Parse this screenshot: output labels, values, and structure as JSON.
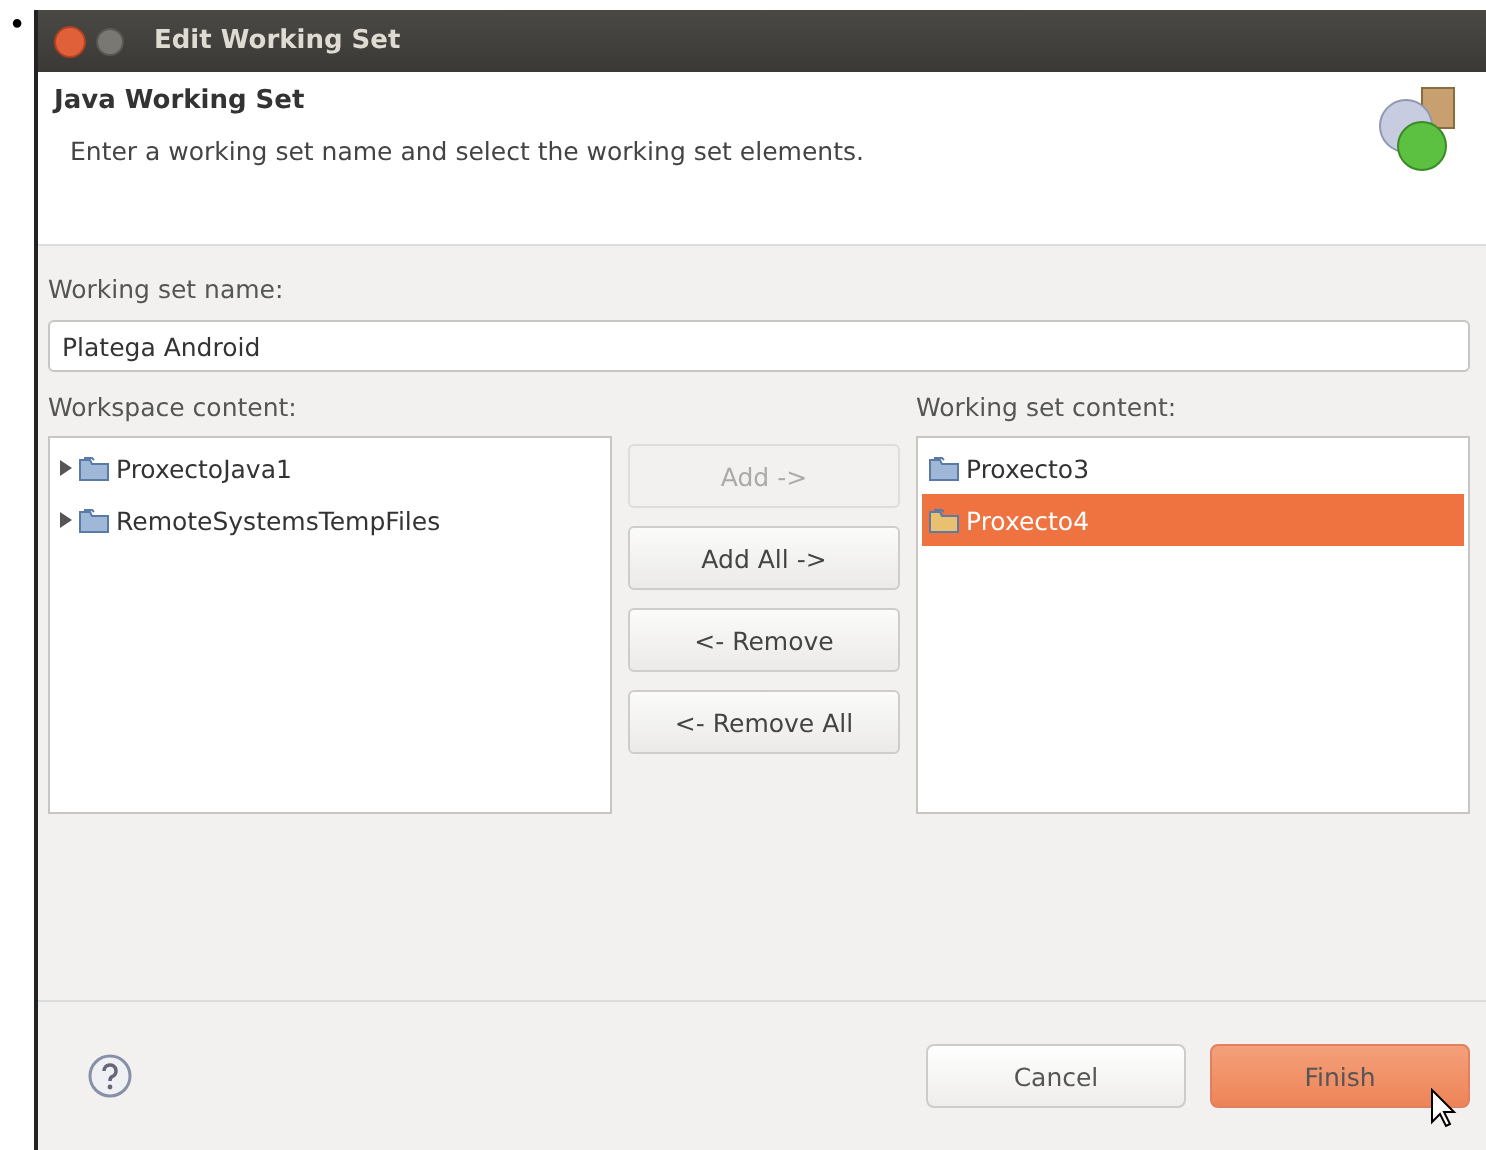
{
  "bullet": "•",
  "window": {
    "title": "Edit Working Set"
  },
  "header": {
    "title": "Java Working Set",
    "description": "Enter a working set name and select the working set elements."
  },
  "name_field": {
    "label": "Working set name:",
    "value": "Platega Android"
  },
  "workspace": {
    "label": "Workspace content:",
    "items": [
      {
        "label": "ProxectoJava1",
        "expanded": false,
        "selected": false
      },
      {
        "label": "RemoteSystemsTempFiles",
        "expanded": false,
        "selected": false
      }
    ]
  },
  "transfer_buttons": [
    {
      "label": "Add ->",
      "disabled": true
    },
    {
      "label": "Add All ->",
      "disabled": false
    },
    {
      "label": "<- Remove",
      "disabled": false
    },
    {
      "label": "<- Remove All",
      "disabled": false
    }
  ],
  "working_set": {
    "label": "Working set content:",
    "items": [
      {
        "label": "Proxecto3",
        "selected": false
      },
      {
        "label": "Proxecto4",
        "selected": true
      }
    ]
  },
  "footer_buttons": [
    {
      "label": "Cancel",
      "kind": "normal"
    },
    {
      "label": "Finish",
      "kind": "default"
    }
  ]
}
